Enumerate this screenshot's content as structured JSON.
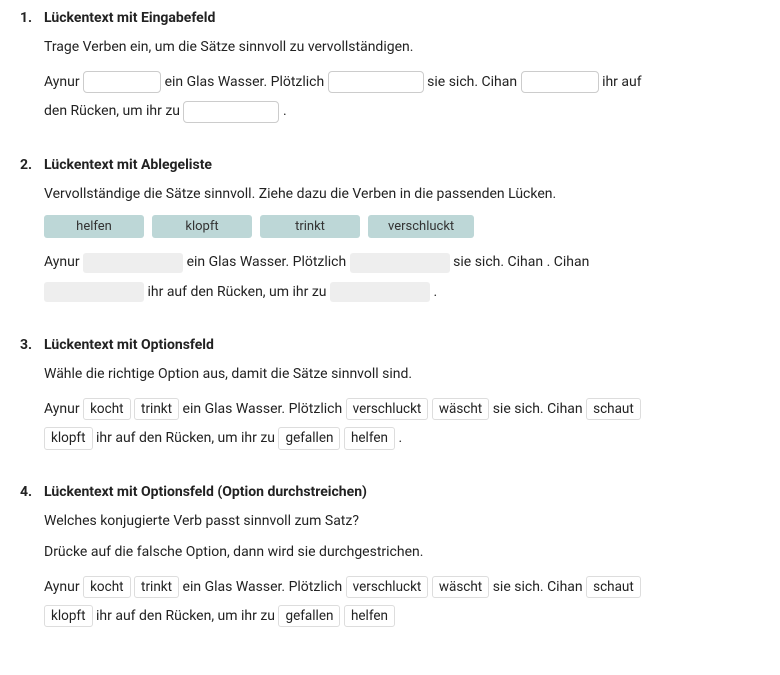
{
  "exercises": [
    {
      "number": "1.",
      "title": "Lückentext mit Eingabefeld",
      "instruction": "Trage Verben ein, um die Sätze sinnvoll zu vervollständigen.",
      "sentence": {
        "t1": "Aynur ",
        "t2": " ein Glas Wasser. Plötzlich ",
        "t3": " sie sich. Cihan ",
        "t4": " ihr auf den Rücken, um ihr zu ",
        "t5": "."
      }
    },
    {
      "number": "2.",
      "title": "Lückentext mit Ablegeliste",
      "instruction": "Vervollständige die Sätze sinnvoll. Ziehe dazu die Verben in die passenden Lücken.",
      "dragItems": [
        "helfen",
        "klopft",
        "trinkt",
        "verschluckt"
      ],
      "sentence": {
        "t1": "Aynur ",
        "t2": " ein Glas Wasser. Plötzlich ",
        "t3": " sie sich. Cihan ",
        "t4": " ihr auf den Rücken, um ihr zu ",
        "t5": "."
      }
    },
    {
      "number": "3.",
      "title": "Lückentext mit Optionsfeld",
      "instruction": "Wähle die richtige Option aus, damit die Sätze sinnvoll sind.",
      "sentence": {
        "t1": "Aynur ",
        "o1a": "kocht",
        "o1b": "trinkt",
        "t2": " ein Glas Wasser. Plötzlich ",
        "o2a": "verschluckt",
        "o2b": "wäscht",
        "t3": " sie sich. Cihan ",
        "o3a": "schaut",
        "o3b": "klopft",
        "t4": " ihr auf den Rücken, um ihr zu ",
        "o4a": "gefallen",
        "o4b": "helfen",
        "t5": " ."
      }
    },
    {
      "number": "4.",
      "title": "Lückentext mit Optionsfeld (Option durchstreichen)",
      "instruction1": "Welches konjugierte Verb passt sinnvoll zum Satz?",
      "instruction2": "Drücke auf die falsche Option, dann wird sie durchgestrichen.",
      "sentence": {
        "t1": "Aynur ",
        "o1a": "kocht",
        "o1b": "trinkt",
        "t2": " ein Glas Wasser. Plötzlich ",
        "o2a": "verschluckt",
        "o2b": "wäscht",
        "t3": " sie sich. Cihan ",
        "o3a": "schaut",
        "o3b": "klopft",
        "t4": " ihr auf den Rücken, um ihr zu ",
        "o4a": "gefallen",
        "o4b": "helfen"
      }
    }
  ]
}
